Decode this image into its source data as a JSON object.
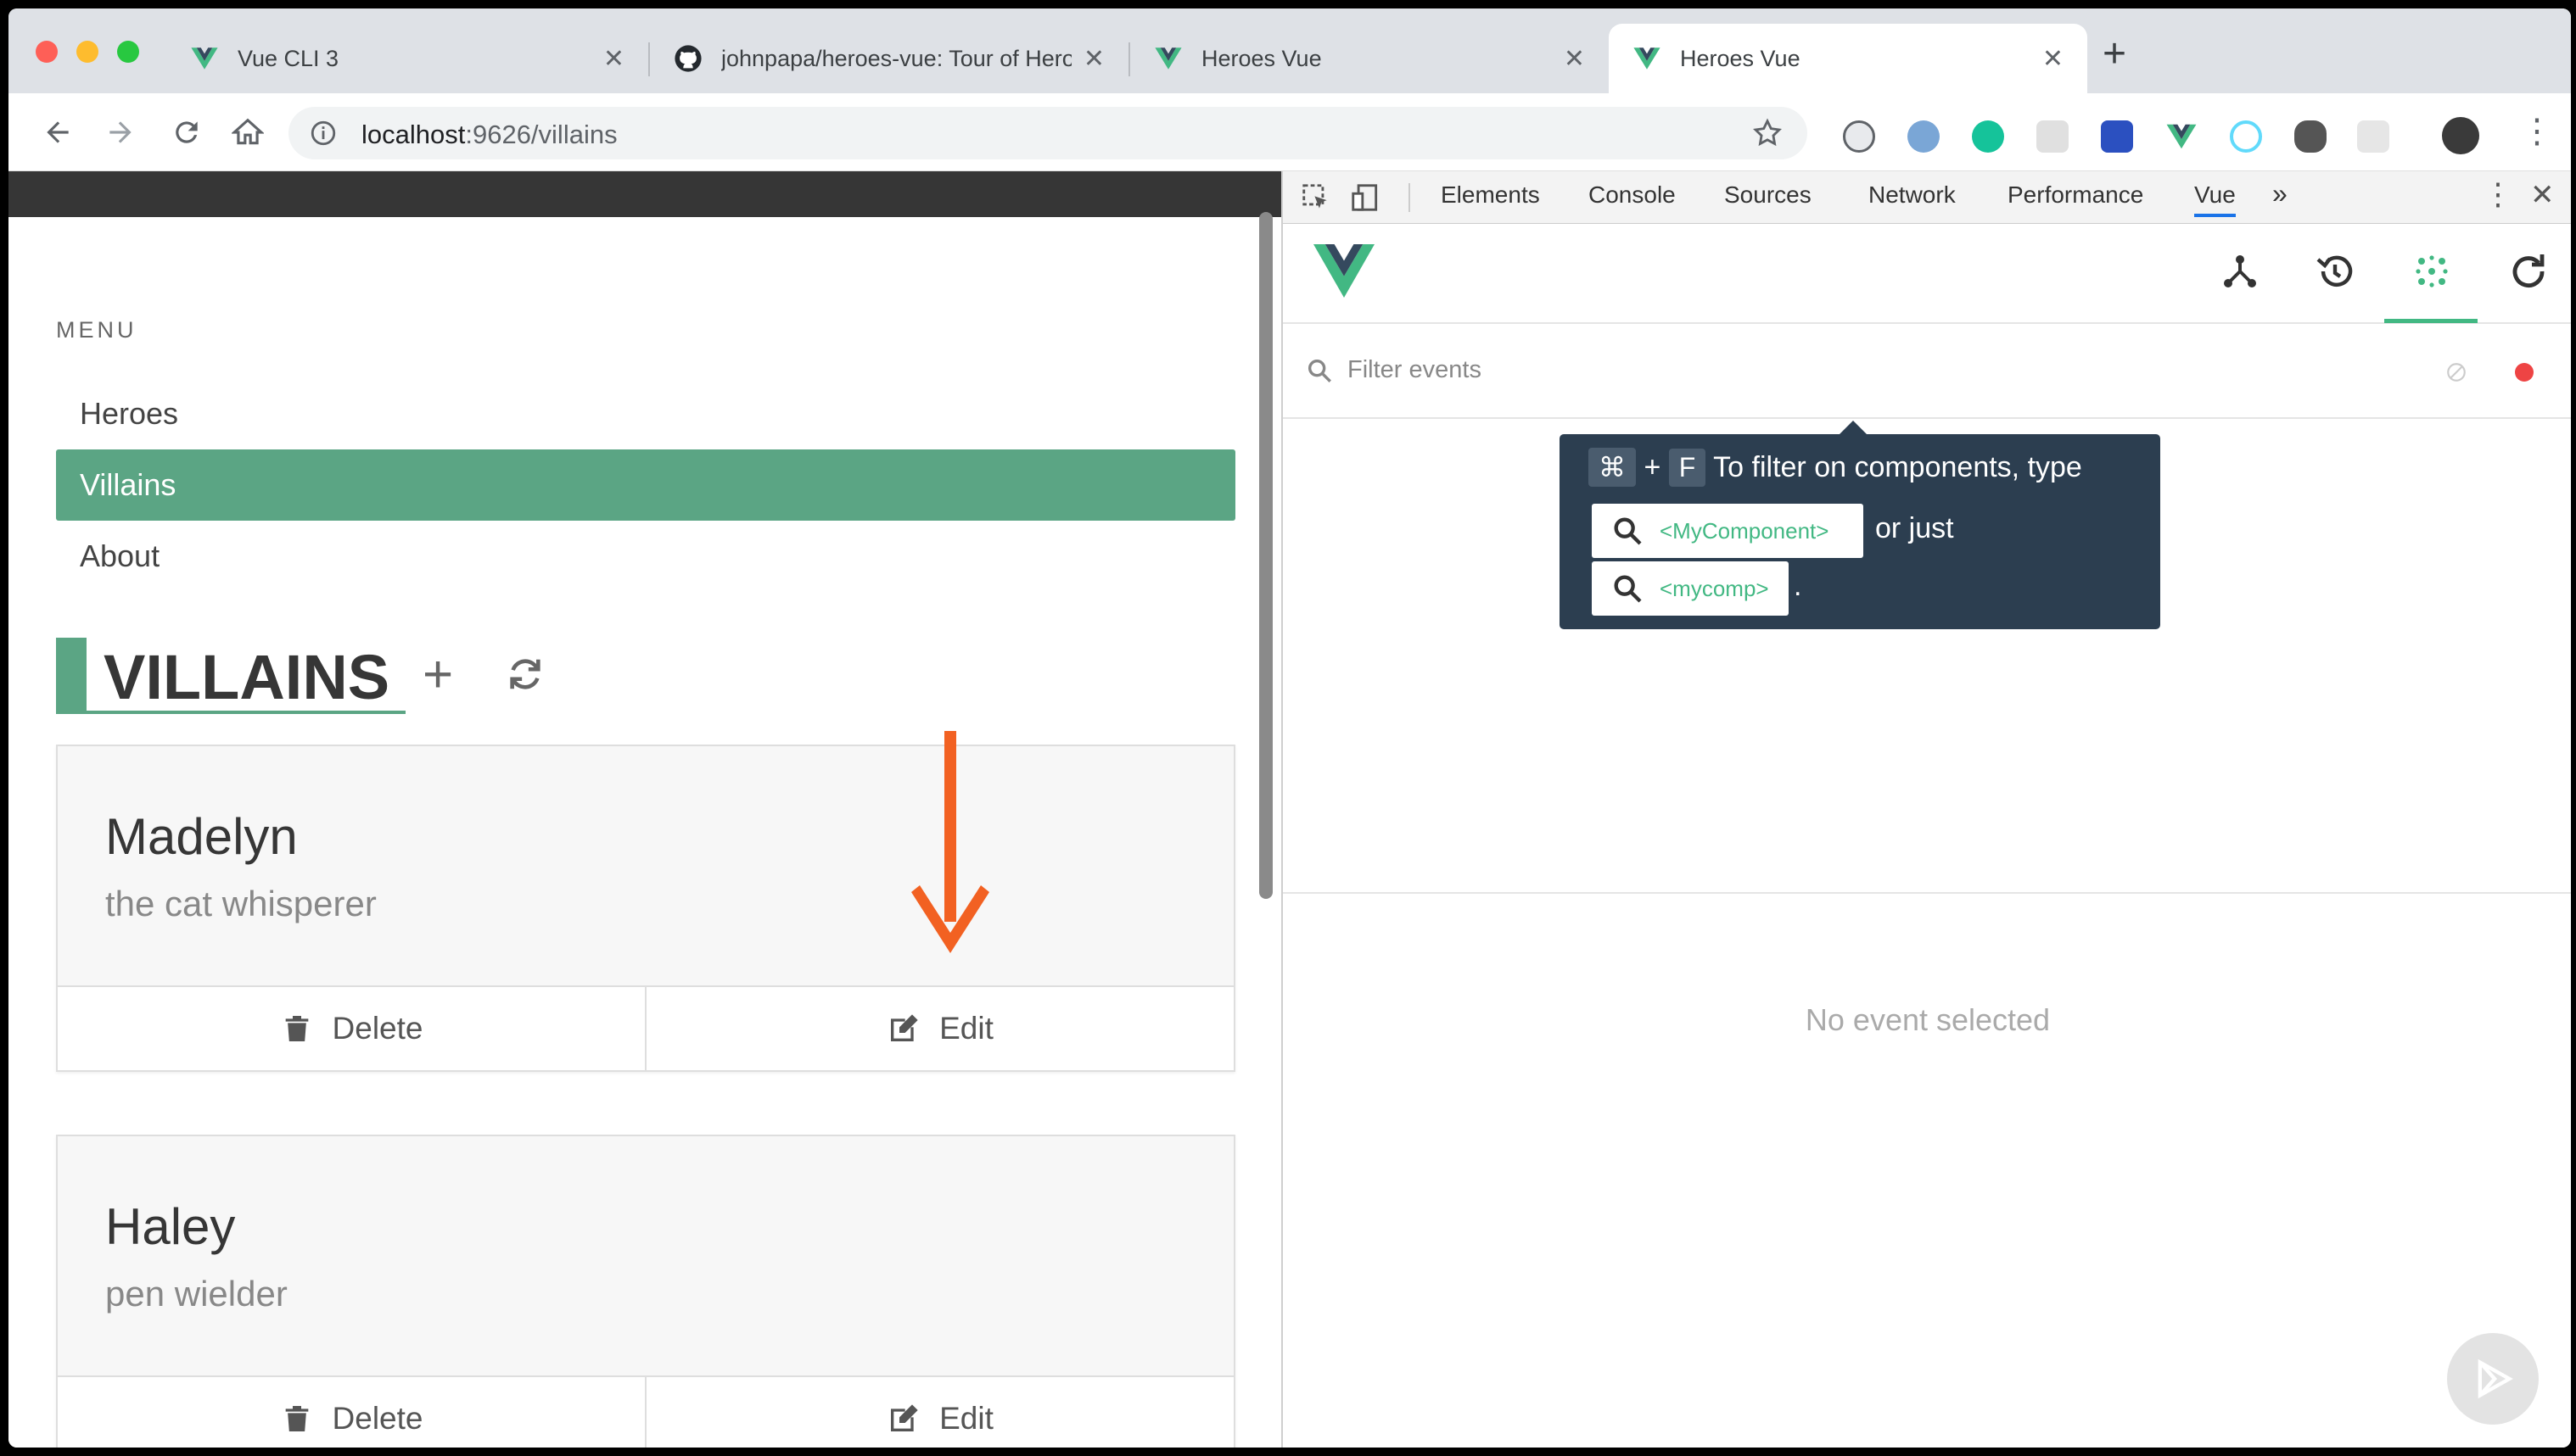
{
  "browser": {
    "tabs": [
      {
        "title": "Vue CLI 3",
        "favicon": "vue-logo-icon",
        "active": false
      },
      {
        "title": "johnpapa/heroes-vue: Tour of Heroes",
        "favicon": "github-icon",
        "active": false
      },
      {
        "title": "Heroes Vue",
        "favicon": "vue-logo-icon",
        "active": false
      },
      {
        "title": "Heroes Vue",
        "favicon": "vue-logo-icon",
        "active": true
      }
    ],
    "url_host": "localhost",
    "url_rest": ":9626/villains"
  },
  "app": {
    "menu_label": "MENU",
    "menu_items": [
      {
        "label": "Heroes",
        "active": false
      },
      {
        "label": "Villains",
        "active": true
      },
      {
        "label": "About",
        "active": false
      }
    ],
    "heading": "VILLAINS",
    "add_label": "+",
    "cards": [
      {
        "name": "Madelyn",
        "description": "the cat whisperer",
        "delete_label": "Delete",
        "edit_label": "Edit"
      },
      {
        "name": "Haley",
        "description": "pen wielder",
        "delete_label": "Delete",
        "edit_label": "Edit"
      }
    ]
  },
  "devtools": {
    "tabs": [
      "Elements",
      "Console",
      "Sources",
      "Network",
      "Performance",
      "Vue"
    ],
    "active_tab": "Vue",
    "more_label": "»",
    "filter_placeholder": "Filter events",
    "tooltip": {
      "key1": "⌘",
      "plus": "+",
      "key2": "F",
      "line1": "To filter on components, type",
      "example1": "<MyComponent>",
      "or_just": "or just",
      "example2": "<mycomp>",
      "period": "."
    },
    "empty_message": "No event selected"
  },
  "colors": {
    "accent": "#5ba584",
    "vue_green": "#42b883",
    "appbar": "#363636",
    "tooltip_bg": "#2c3e50"
  }
}
